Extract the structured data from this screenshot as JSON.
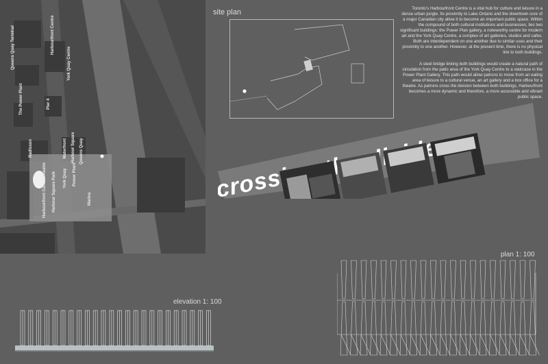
{
  "site_plan": {
    "label": "site plan"
  },
  "description": {
    "paragraph_1": "Toronto’s Harbourfront Centre is a vital hub for culture and leisure in a dense urban jungle. Its proximity to Lake Ontario and the downtown core of a major Canadian city allow it to become an important public space. Within the compound of both cultural institutions and businesses, lies two significant buildings: the Power Plan gallery, a noteworthy centre for modern art and the York Quay Centre, a complex of art galleries, studios and cafes. Both are interdependent on one another due to similar uses and their proximity to one another. However, at the present time, there is no physical link to both buildings.",
    "paragraph_2": "A steel bridge linking both buildings would create a natural path of circulation from the patio area of the York Quay Centre to a staircase in the Power Plant Gallery. This path would allow patrons to move from an eating area of leisure to a cultural venue, an art gallery and a box office for a theatre. As patrons cross the division between both buildings, Harbourfront becomes a more dynamic and therefore, a more accessible and vibrant public space."
  },
  "banner": {
    "title": "crossing the divide"
  },
  "map_labels": {
    "label_1": "Queens Quay Terminal",
    "label_2": "Harbourfront Centre",
    "label_3": "York Quay Centre",
    "label_4": "The Power Plant",
    "label_5": "Pier 4",
    "label_6": "Radisson",
    "label_7": "Waterfront",
    "label_8": "Harbour Square",
    "label_9": "Queens Quay",
    "label_10": "Harbourfront Centre Theatre",
    "label_11": "Harbour Square Park",
    "label_12": "York Quay",
    "label_13": "Power Plant",
    "label_14": "Marina"
  },
  "elevation": {
    "label": "elevation 1: 100"
  },
  "plan": {
    "label": "plan 1: 100"
  },
  "colors": {
    "background": "#5f5f5f",
    "map_dark": "#404040",
    "map_road": "#7a7a7a",
    "highlight": "#8e8e8e",
    "banner": "#777777",
    "line": "#d8d8d8"
  }
}
